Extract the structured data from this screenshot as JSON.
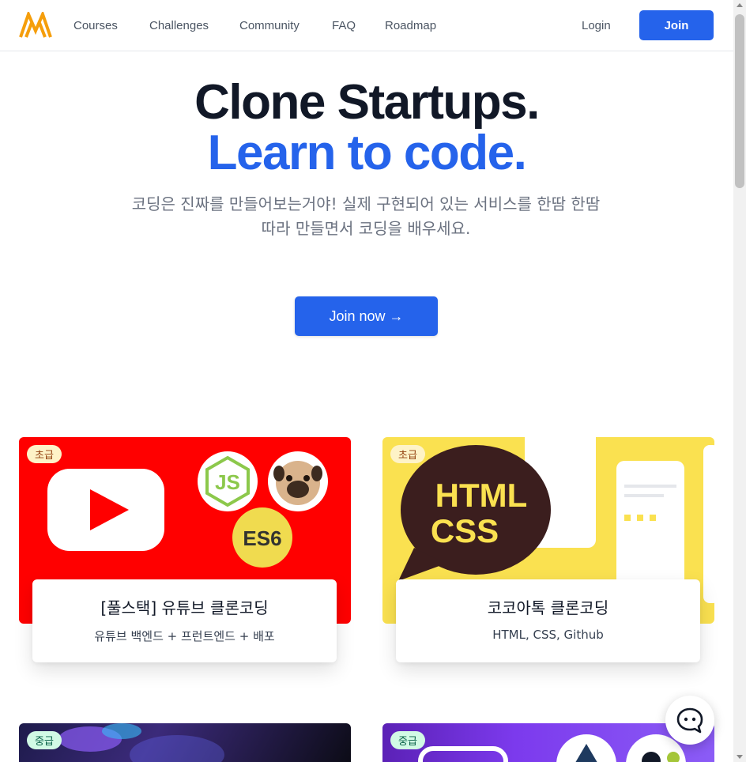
{
  "nav": {
    "links": [
      "Courses",
      "Challenges",
      "Community",
      "FAQ",
      "Roadmap"
    ],
    "login": "Login",
    "join": "Join"
  },
  "hero": {
    "title_line1": "Clone Startups.",
    "title_line2": "Learn to code.",
    "subtitle": "코딩은 진짜를 만들어보는거야! 실제 구현되어 있는 서비스를 한땀 한땀 따라 만들면서 코딩을 배우세요.",
    "cta": "Join now →"
  },
  "courses": [
    {
      "badge": "초급",
      "title": "[풀스택] 유튜브 클론코딩",
      "desc": "유튜브 백엔드 + 프런트엔드 + 배포",
      "image_text": [
        "JS",
        "ES6"
      ]
    },
    {
      "badge": "초급",
      "title": "코코아톡 클론코딩",
      "desc": "HTML, CSS, Github",
      "image_text": [
        "HTML",
        "CSS"
      ]
    },
    {
      "badge": "중급"
    },
    {
      "badge": "중급"
    }
  ],
  "colors": {
    "primary": "#2563eb",
    "youtube_red": "#ff0000",
    "kakao_yellow": "#fae150"
  },
  "icons": [
    "logo-icon",
    "youtube-play-icon",
    "nodejs-icon",
    "pug-icon",
    "chat-icon"
  ]
}
